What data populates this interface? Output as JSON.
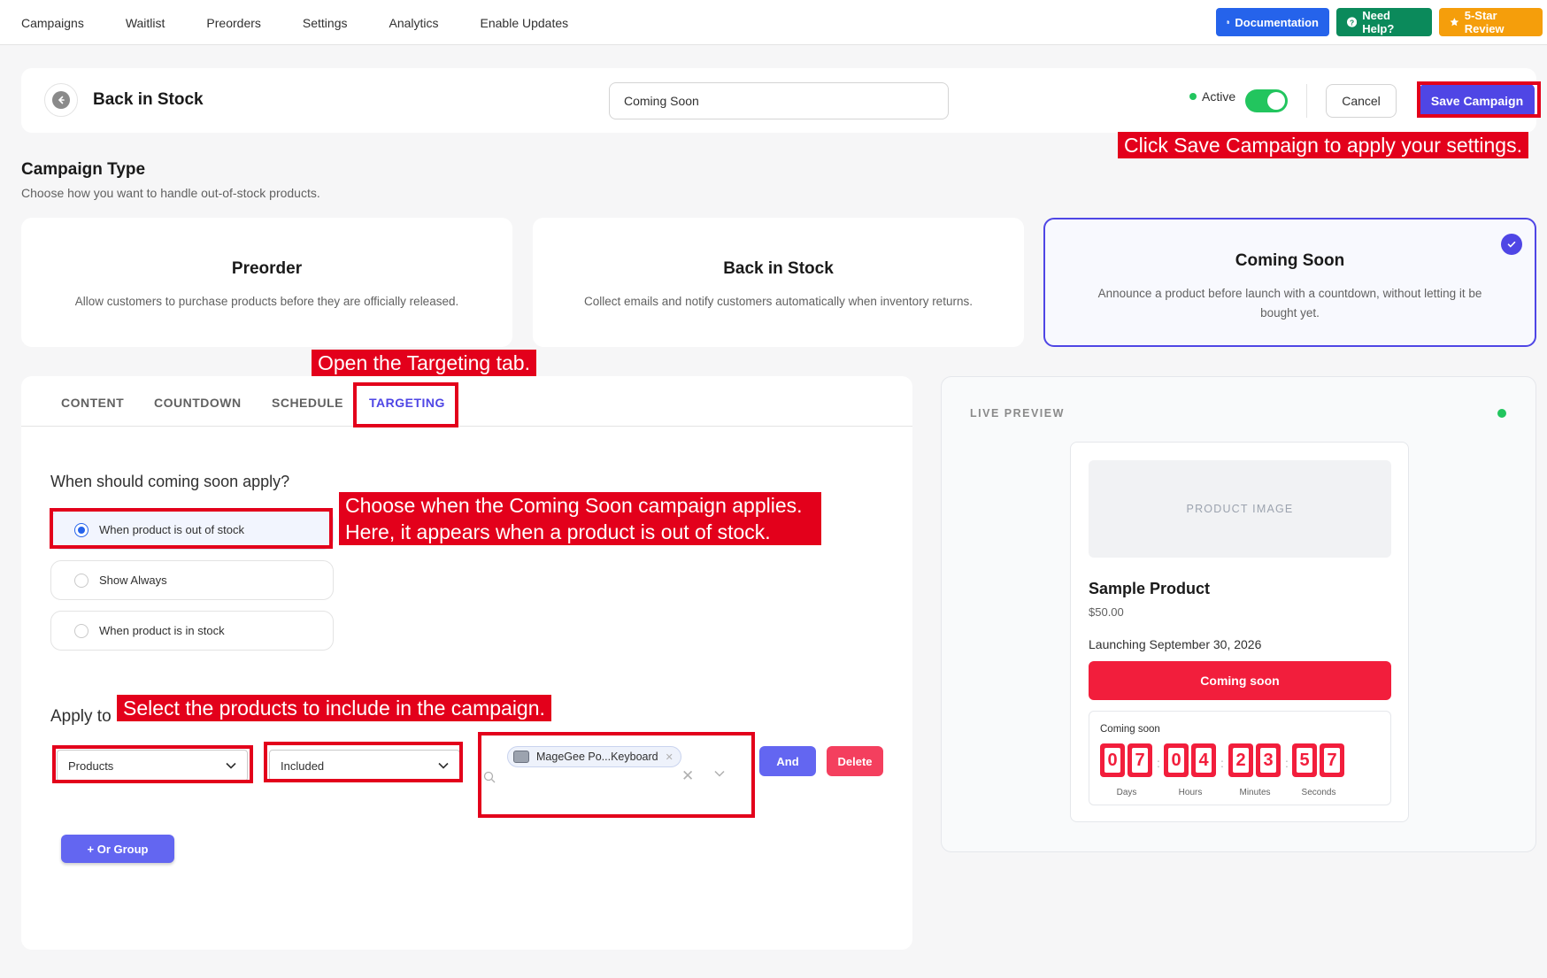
{
  "nav": {
    "links": [
      "Campaigns",
      "Waitlist",
      "Preorders",
      "Settings",
      "Analytics",
      "Enable Updates"
    ],
    "buttons": {
      "documentation": "Documentation",
      "help": "Need Help?",
      "review": "5-Star Review"
    }
  },
  "header": {
    "title": "Back in Stock",
    "campaign_name": "Coming Soon",
    "status": "Active",
    "cancel": "Cancel",
    "save": "Save Campaign"
  },
  "campaign_type": {
    "title": "Campaign Type",
    "subtitle": "Choose how you want to handle out-of-stock products.",
    "cards": [
      {
        "title": "Preorder",
        "desc": "Allow customers to purchase products before they are officially released."
      },
      {
        "title": "Back in Stock",
        "desc": "Collect emails and notify customers automatically when inventory returns."
      },
      {
        "title": "Coming Soon",
        "desc": "Announce a product before launch with a countdown, without letting it be bought yet."
      }
    ],
    "selected": "Coming Soon"
  },
  "tabs": [
    "CONTENT",
    "COUNTDOWN",
    "SCHEDULE",
    "TARGETING"
  ],
  "active_tab": "TARGETING",
  "targeting": {
    "question": "When should coming soon apply?",
    "options": [
      "When product is out of stock",
      "Show Always",
      "When product is in stock"
    ],
    "selected_option": "When product is out of stock",
    "apply_title": "Apply to",
    "apply_type": "Products",
    "condition": "Included",
    "selected_products": [
      "MageGee Po...Keyboard"
    ],
    "and_label": "And",
    "delete_label": "Delete",
    "or_group_label": "+ Or Group"
  },
  "preview": {
    "label": "LIVE PREVIEW",
    "image_placeholder": "PRODUCT IMAGE",
    "product_name": "Sample Product",
    "price": "$50.00",
    "launch_text": "Launching September 30, 2026",
    "button_label": "Coming soon",
    "countdown_label": "Coming soon",
    "countdown": {
      "days": [
        "0",
        "7"
      ],
      "hours": [
        "0",
        "4"
      ],
      "minutes": [
        "2",
        "3"
      ],
      "seconds": [
        "5",
        "7"
      ]
    },
    "units": {
      "days": "Days",
      "hours": "Hours",
      "minutes": "Minutes",
      "seconds": "Seconds"
    }
  },
  "annotations": {
    "save": "Click Save Campaign to apply your settings.",
    "tab": "Open the Targeting tab.",
    "when_line1": "Choose when the Coming Soon campaign applies.",
    "when_line2": "Here, it appears when a product is out of stock.",
    "products": "Select the products to include in the campaign."
  },
  "colors": {
    "accent": "#4f46e5",
    "active_green": "#22c55e",
    "coming_soon_red": "#f21e3c",
    "annotation_red": "#e3001b"
  }
}
